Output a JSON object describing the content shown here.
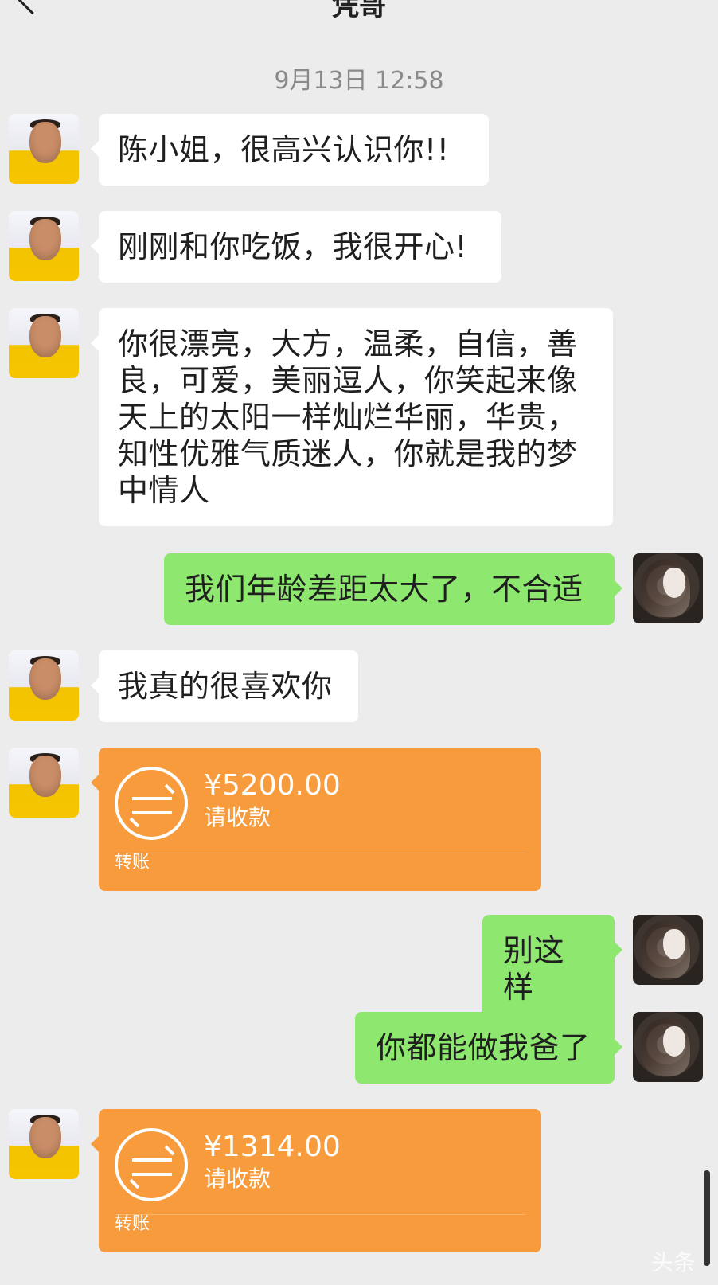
{
  "header": {
    "title": "凭哥",
    "back_label": "<"
  },
  "chat": {
    "timestamp": "9月13日 12:58",
    "messages": [
      {
        "sender": "contact",
        "text": "陈小姐，很高兴认识你!!"
      },
      {
        "sender": "contact",
        "text": "刚刚和你吃饭，我很开心!"
      },
      {
        "sender": "contact",
        "text": "你很漂亮，大方，温柔，自信，善良，可爱，美丽逗人，你笑起来像天上的太阳一样灿烂华丽，华贵，知性优雅气质迷人，你就是我的梦中情人"
      },
      {
        "sender": "me",
        "text": "我们年龄差距太大了，不合适"
      },
      {
        "sender": "contact",
        "text": "我真的很喜欢你"
      },
      {
        "sender": "contact",
        "type": "transfer",
        "amount": "¥5200.00",
        "label": "请收款",
        "footer": "转账"
      },
      {
        "sender": "me",
        "text": "别这样"
      },
      {
        "sender": "me",
        "text": "你都能做我爸了"
      },
      {
        "sender": "contact",
        "type": "transfer",
        "amount": "¥1314.00",
        "label": "请收款",
        "footer": "转账"
      }
    ]
  },
  "colors": {
    "background": "#ececec",
    "incoming_bubble": "#ffffff",
    "outgoing_bubble": "#8ee86f",
    "transfer_bubble": "#f79b3c",
    "text": "#1f1f1f",
    "timestamp": "#8a8a8a"
  },
  "icons": {
    "back": "back-icon",
    "transfer": "transfer-icon",
    "avatar": "avatar"
  },
  "watermark": "头条"
}
